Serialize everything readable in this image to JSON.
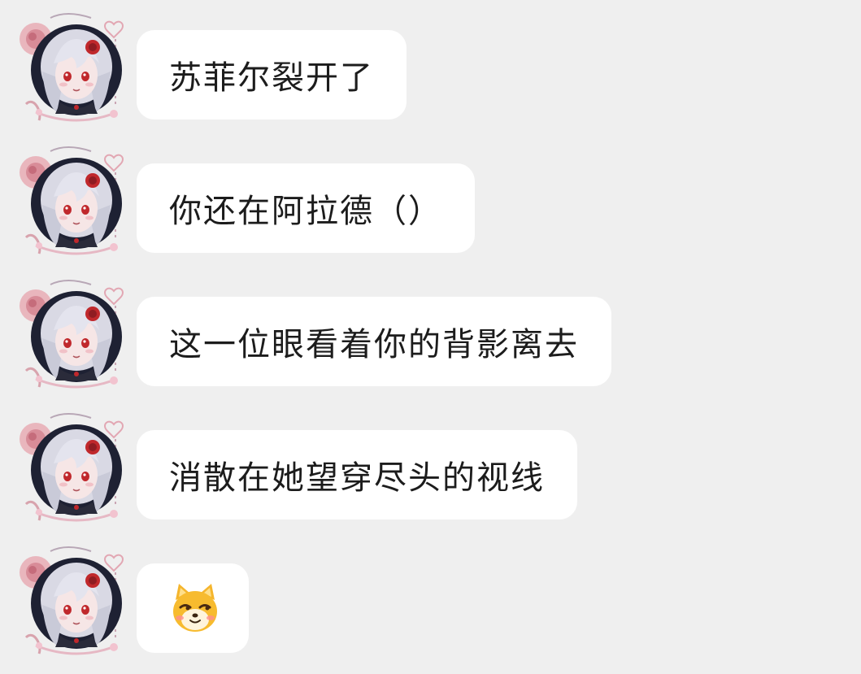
{
  "chat": {
    "messages": [
      {
        "type": "text",
        "text": "苏菲尔裂开了"
      },
      {
        "type": "text",
        "text": "你还在阿拉德（）"
      },
      {
        "type": "text",
        "text": "这一位眼看着你的背影离去"
      },
      {
        "type": "text",
        "text": "消散在她望穿尽头的视线"
      },
      {
        "type": "sticker",
        "sticker": "shiba-dog-smirk-emoji"
      }
    ],
    "avatar": {
      "icon": "anime-girl-avatar-with-roses",
      "accent_colors": [
        "#1e2133",
        "#d9d9e4",
        "#c0282c",
        "#e8c0c4"
      ]
    }
  },
  "colors": {
    "background": "#efefef",
    "bubble": "#ffffff",
    "text": "#1c1c1c"
  }
}
